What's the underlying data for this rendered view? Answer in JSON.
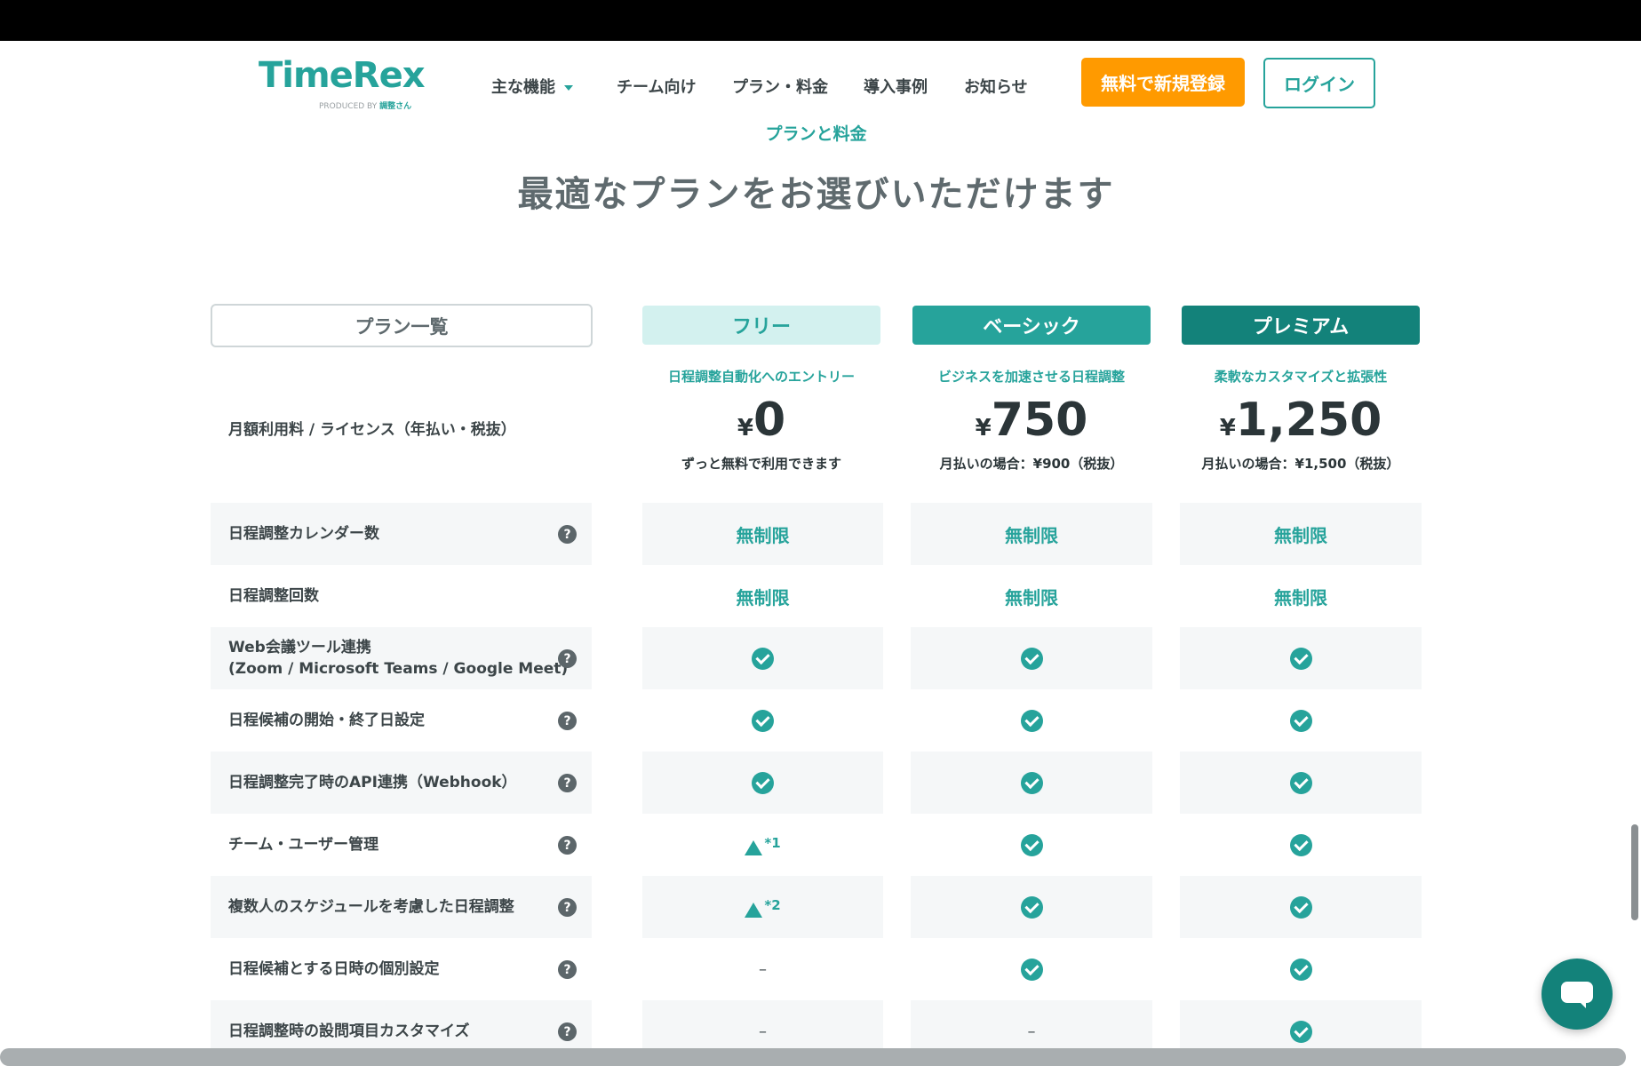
{
  "header": {
    "logo_main": "TimeRex",
    "logo_sub_prefix": "PRODUCED BY",
    "logo_sub_brand": "調整さん",
    "nav": [
      "主な機能",
      "チーム向け",
      "プラン・料金",
      "導入事例",
      "お知らせ"
    ],
    "signup_label": "無料で新規登録",
    "login_label": "ログイン"
  },
  "section": {
    "eyebrow": "プランと料金",
    "title": "最適なプランをお選びいただけます"
  },
  "plan_list_label": "プラン一覧",
  "fee_label": "月額利用料 / ライセンス（年払い・税抜）",
  "plans": [
    {
      "name": "フリー",
      "tagline": "日程調整自動化へのエントリー",
      "currency": "¥",
      "price": "0",
      "note": "ずっと無料で利用できます"
    },
    {
      "name": "ベーシック",
      "tagline": "ビジネスを加速させる日程調整",
      "currency": "¥",
      "price": "750",
      "note": "月払いの場合：¥900（税抜）"
    },
    {
      "name": "プレミアム",
      "tagline": "柔軟なカスタマイズと拡張性",
      "currency": "¥",
      "price": "1,250",
      "note": "月払いの場合：¥1,500（税抜）"
    }
  ],
  "help_glyph": "?",
  "unlimited": "無制限",
  "dash": "–",
  "notes": {
    "n1": "*1",
    "n2": "*2"
  },
  "features": [
    {
      "label": "日程調整カレンダー数",
      "values": [
        "unlimited",
        "unlimited",
        "unlimited"
      ]
    },
    {
      "label": "日程調整回数",
      "values": [
        "unlimited",
        "unlimited",
        "unlimited"
      ]
    },
    {
      "label": "Web会議ツール連携\n(Zoom / Microsoft Teams / Google Meet)",
      "values": [
        "check",
        "check",
        "check"
      ]
    },
    {
      "label": "日程候補の開始・終了日設定",
      "values": [
        "check",
        "check",
        "check"
      ]
    },
    {
      "label": "日程調整完了時のAPI連携（Webhook）",
      "values": [
        "check",
        "check",
        "check"
      ]
    },
    {
      "label": "チーム・ユーザー管理",
      "values": [
        "partial-1",
        "check",
        "check"
      ]
    },
    {
      "label": "複数人のスケジュールを考慮した日程調整",
      "values": [
        "partial-2",
        "check",
        "check"
      ]
    },
    {
      "label": "日程候補とする日時の個別設定",
      "values": [
        "none",
        "check",
        "check"
      ]
    },
    {
      "label": "日程調整時の設問項目カスタマイズ",
      "values": [
        "none",
        "none",
        "check"
      ]
    }
  ],
  "icons": {
    "help": "question-circle-icon",
    "check": "check-circle-icon",
    "partial": "triangle-icon",
    "chat": "chat-bubble-icon"
  },
  "colors": {
    "accent": "#26a39b",
    "accent_dark": "#13827a",
    "signup": "#ff9a00"
  }
}
